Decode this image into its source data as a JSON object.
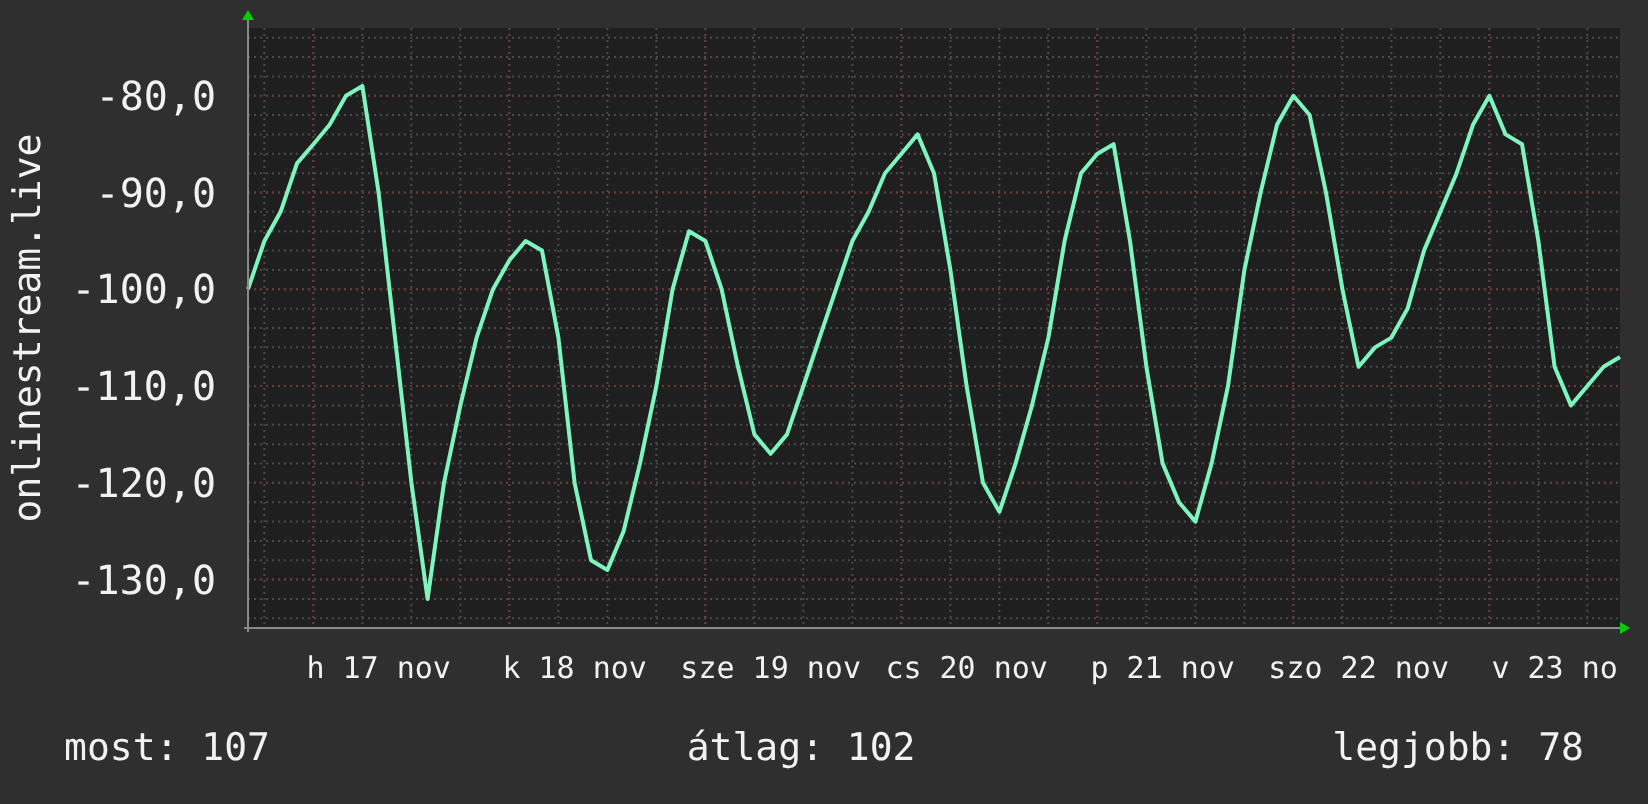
{
  "chart": {
    "chart_data": {
      "type": "line",
      "ylabel": "onlinestream.live",
      "categories": [
        null,
        null,
        null,
        null,
        null,
        null,
        null,
        null,
        "h 17 nov",
        null,
        null,
        null,
        null,
        null,
        null,
        null,
        null,
        null,
        null,
        null,
        "k 18 nov",
        null,
        null,
        null,
        null,
        null,
        null,
        null,
        null,
        null,
        null,
        null,
        "sze 19 nov",
        null,
        null,
        null,
        null,
        null,
        null,
        null,
        null,
        null,
        null,
        null,
        "cs 20 nov",
        null,
        null,
        null,
        null,
        null,
        null,
        null,
        null,
        null,
        null,
        null,
        "p 21 nov",
        null,
        null,
        null,
        null,
        null,
        null,
        null,
        null,
        null,
        null,
        null,
        "szo 22 nov",
        null,
        null,
        null,
        null,
        null,
        null,
        null,
        null,
        null,
        null,
        null,
        "v 23 no",
        null,
        null,
        null,
        null
      ],
      "series": [
        {
          "color": "#7ef5bf",
          "values": [
            -100,
            -95,
            -92,
            -87,
            -85,
            -83,
            -80,
            -79,
            -90,
            -105,
            -120,
            -132,
            -120,
            -112,
            -105,
            -100,
            -97,
            -95,
            -96,
            -105,
            -120,
            -128,
            -129,
            -125,
            -118,
            -110,
            -100,
            -94,
            -95,
            -100,
            -108,
            -115,
            -117,
            -115,
            -110,
            -105,
            -100,
            -95,
            -92,
            -88,
            -86,
            -84,
            -88,
            -98,
            -110,
            -120,
            -123,
            -118,
            -112,
            -105,
            -95,
            -88,
            -86,
            -85,
            -95,
            -108,
            -118,
            -122,
            -124,
            -118,
            -110,
            -98,
            -90,
            -83,
            -80,
            -82,
            -90,
            -100,
            -108,
            -106,
            -105,
            -102,
            -96,
            -92,
            -88,
            -83,
            -80,
            -84,
            -85,
            -95,
            -108,
            -112,
            -110,
            -108,
            -107
          ]
        }
      ],
      "grid": true,
      "ylim": [
        -135,
        -73
      ],
      "yticks": [
        {
          "value": -80,
          "label": "-80,0"
        },
        {
          "value": -90,
          "label": "-90,0"
        },
        {
          "value": -100,
          "label": "-100,0"
        },
        {
          "value": -110,
          "label": "-110,0"
        },
        {
          "value": -120,
          "label": "-120,0"
        },
        {
          "value": -130,
          "label": "-130,0"
        }
      ]
    }
  },
  "legend": [
    "most: 107",
    "átlag: 102",
    "legjobb: 78"
  ]
}
